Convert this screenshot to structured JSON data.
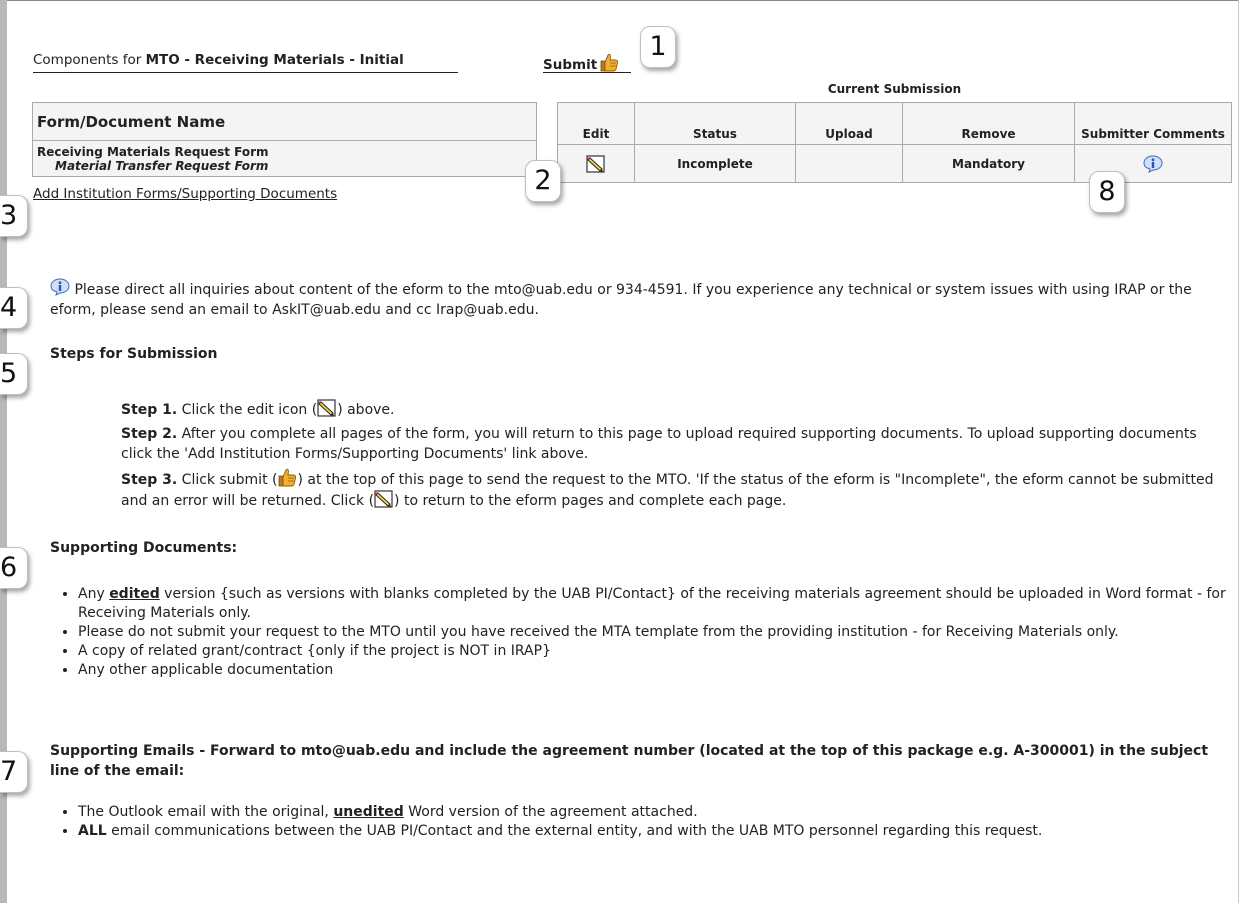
{
  "header": {
    "components_prefix": "Components for ",
    "package_name": "MTO - Receiving Materials - Initial",
    "submit_label": "Submit"
  },
  "form_table": {
    "header": "Form/Document Name",
    "form_name": "Receiving Materials Request Form",
    "form_subtitle": "Material Transfer Request Form"
  },
  "submission_table": {
    "title": "Current Submission",
    "columns": [
      "Edit",
      "Status",
      "Upload",
      "Remove",
      "Submitter Comments"
    ],
    "status": "Incomplete",
    "upload": "",
    "remove": "Mandatory"
  },
  "add_link": "Add Institution Forms/Supporting Documents",
  "badges": [
    "1",
    "2",
    "3",
    "4",
    "5",
    "6",
    "7",
    "8"
  ],
  "inquiry": {
    "text_1": " Please direct all inquiries about content of the eform to the ",
    "email_mto": "mto@uab.edu",
    "text_2": " or 934-4591. If you experience any technical or system issues with using IRAP or the eform, please send an email to ",
    "email_askit": "AskIT@uab.edu",
    "text_3": " and cc Irap@uab.edu."
  },
  "steps": {
    "heading": "Steps for Submission",
    "step1_label": "Step 1.",
    "step1_a": " Click the edit icon (",
    "step1_b": ") above.",
    "step2_label": "Step 2.",
    "step2_text": " After you complete all pages of the form, you will return to this page to upload required supporting documents. To upload supporting documents click the 'Add Institution Forms/Supporting Documents' link above.",
    "step3_label": "Step 3.",
    "step3_a": " Click submit (",
    "step3_b": ") at the top of this page to send the request to the MTO. 'If the status of the eform is \"Incomplete\", the eform cannot be submitted and an error will be returned. Click (",
    "step3_c": ") to return to the eform pages and complete each page."
  },
  "supporting_documents": {
    "heading": "Supporting Documents:",
    "item1_a": "Any ",
    "item1_emph": "edited",
    "item1_b": " version {such as versions with blanks completed by the UAB PI/Contact} of the receiving materials agreement should be uploaded in Word format - for Receiving Materials only.",
    "item2": "Please do not submit your request to the MTO until you have received the MTA template from the providing institution - for Receiving Materials only.",
    "item3": "A copy of related grant/contract {only if the project is NOT in IRAP}",
    "item4": "Any other applicable documentation"
  },
  "supporting_emails": {
    "heading": "Supporting Emails - Forward to mto@uab.edu and include the agreement number (located at the top of this package e.g. A-300001) in the subject line of the email:",
    "item1_a": "The Outlook email with the original, ",
    "item1_emph": "unedited",
    "item1_b": " Word version of the agreement attached.",
    "item2_emph": "ALL",
    "item2_b": " email communications between the UAB PI/Contact and the external entity, and with the UAB MTO personnel regarding this request."
  },
  "colors": {
    "thumb": "#e8a21a",
    "pencil": "#e8d23a",
    "info": "#3b6fc2"
  }
}
